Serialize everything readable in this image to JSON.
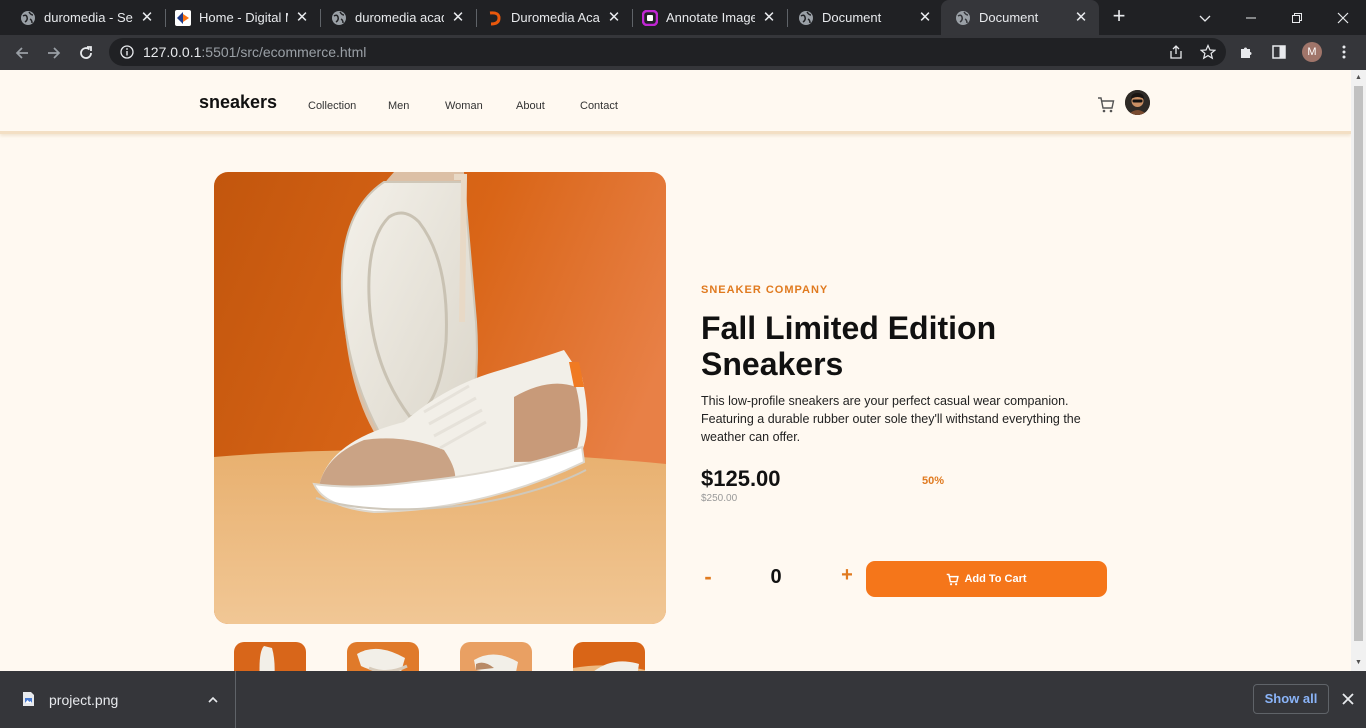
{
  "browser": {
    "tabs": [
      {
        "title": "duromedia - Search",
        "icon": "globe-icon"
      },
      {
        "title": "Home - Digital Marketing",
        "icon": "digital-logo-icon"
      },
      {
        "title": "duromedia academy",
        "icon": "globe-icon"
      },
      {
        "title": "Duromedia Academy",
        "icon": "duromedia-logo-icon"
      },
      {
        "title": "Annotate Image",
        "icon": "annotate-logo-icon"
      },
      {
        "title": "Document",
        "icon": "globe-icon"
      },
      {
        "title": "Document",
        "icon": "globe-icon",
        "active": true
      }
    ],
    "url_host": "127.0.0.1",
    "url_path": ":5501/src/ecommerce.html",
    "profile_initial": "M"
  },
  "site": {
    "logo": "sneakers",
    "nav": [
      "Collection",
      "Men",
      "Woman",
      "About",
      "Contact"
    ]
  },
  "product": {
    "company": "SNEAKER COMPANY",
    "title": "Fall Limited Edition Sneakers",
    "description": "This low-profile sneakers are your perfect casual wear companion. Featuring a durable rubber outer sole they'll withstand everything the weather can offer.",
    "price": "$125.00",
    "discount": "50%",
    "old_price": "$250.00",
    "quantity": "0",
    "minus_label": "-",
    "plus_label": "+",
    "add_to_cart_label": "Add To Cart"
  },
  "downloads": {
    "file_name": "project.png",
    "show_all_label": "Show all"
  },
  "colors": {
    "accent": "#f5761a",
    "page_bg": "#fff9f1",
    "chrome_dark": "#202124",
    "chrome_toolbar": "#35363a"
  }
}
